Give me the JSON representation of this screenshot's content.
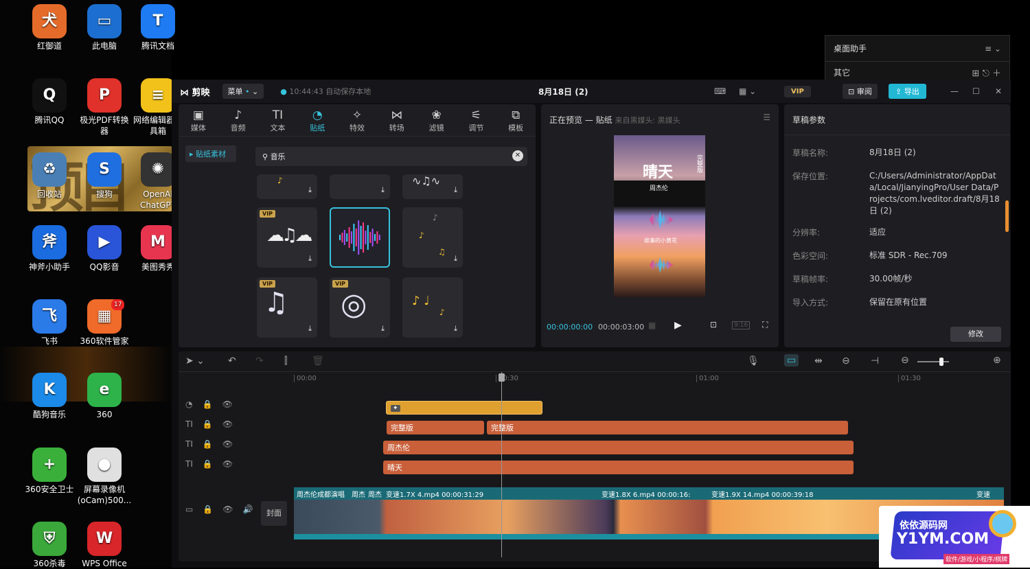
{
  "desktop": {
    "icons": [
      {
        "label": "红御道",
        "color": "#e56b2a",
        "glyph": "犬"
      },
      {
        "label": "此电脑",
        "color": "#1c6fd0",
        "glyph": "▭"
      },
      {
        "label": "腾讯文档",
        "color": "#1e7bf2",
        "glyph": "T"
      },
      {
        "label": "腾讯QQ",
        "color": "#111111",
        "glyph": "Q"
      },
      {
        "label": "极光PDF转换器",
        "color": "#e0322a",
        "glyph": "P"
      },
      {
        "label": "网络编辑器工具箱",
        "color": "#f2c21b",
        "glyph": "≡"
      },
      {
        "label": "回收站",
        "color": "#4a7fb5",
        "glyph": "♻"
      },
      {
        "label": "搜狗",
        "color": "#1f6fe0",
        "glyph": "S"
      },
      {
        "label": "OpenAI ChatGPT",
        "color": "#333333",
        "glyph": "✺"
      },
      {
        "label": "神斧小助手",
        "color": "#1a6ce0",
        "glyph": "斧"
      },
      {
        "label": "QQ影音",
        "color": "#2a55d8",
        "glyph": "▶"
      },
      {
        "label": "美图秀秀",
        "color": "#e8354f",
        "glyph": "M"
      },
      {
        "label": "飞书",
        "color": "#2a7ae8",
        "glyph": "飞"
      },
      {
        "label": "360软件管家",
        "color": "#f06a2a",
        "glyph": "▦",
        "badge": "17"
      },
      {
        "label": "酷狗音乐",
        "color": "#1b8ae8",
        "glyph": "K"
      },
      {
        "label": "360",
        "color": "#2db34a",
        "glyph": "e"
      },
      {
        "label": "360安全卫士",
        "color": "#3ab03a",
        "glyph": "+"
      },
      {
        "label": "屏幕录像机(oCam)500...",
        "color": "#e0e0e0",
        "glyph": "●"
      },
      {
        "label": "360杀毒",
        "color": "#3aa83a",
        "glyph": "⛨"
      },
      {
        "label": "WPS Office",
        "color": "#d8262a",
        "glyph": "W"
      }
    ],
    "helper": {
      "title": "桌面助手",
      "sub": "其它"
    }
  },
  "app": {
    "logo": "剪映",
    "menu": "菜单",
    "autosave": "10:44:43 自动保存本地",
    "project_title": "8月18日 (2)",
    "vip": "VIP",
    "review": "审阅",
    "export": "导出",
    "tools": [
      {
        "label": "媒体",
        "glyph": "▣"
      },
      {
        "label": "音频",
        "glyph": "♪"
      },
      {
        "label": "文本",
        "glyph": "TI"
      },
      {
        "label": "贴纸",
        "glyph": "◔"
      },
      {
        "label": "特效",
        "glyph": "✧"
      },
      {
        "label": "转场",
        "glyph": "⋈"
      },
      {
        "label": "滤镜",
        "glyph": "❀"
      },
      {
        "label": "调节",
        "glyph": "⚟"
      },
      {
        "label": "模板",
        "glyph": "⧉"
      }
    ],
    "sidebar_item": "贴纸素材",
    "search_value": "音乐",
    "preview_title": "正在预览 — 贴纸",
    "preview_sub": "来自黑媒头: 黑媒头",
    "preview_texts": {
      "big": "晴天",
      "artist": "周杰伦",
      "side": "完整版",
      "caption": "故事的小黄花"
    },
    "time_current": "00:00:00:00",
    "time_total": "00:00:03:00",
    "params": {
      "title": "草稿参数",
      "rows": [
        {
          "label": "草稿名称:",
          "value": "8月18日 (2)"
        },
        {
          "label": "保存位置:",
          "value": "C:/Users/Administrator/AppData/Local/JianyingPro/User Data/Projects/com.lveditor.draft/8月18日 (2)"
        },
        {
          "label": "分辨率:",
          "value": "适应"
        },
        {
          "label": "色彩空间:",
          "value": "标准 SDR - Rec.709"
        },
        {
          "label": "草稿帧率:",
          "value": "30.00帧/秒"
        },
        {
          "label": "导入方式:",
          "value": "保留在原有位置"
        }
      ],
      "modify": "修改"
    },
    "ruler": [
      "00:00",
      "00:30",
      "01:00",
      "01:30"
    ],
    "clips": {
      "text1a": "完整版",
      "text1b": "完整版",
      "text2": "周杰伦",
      "text3": "晴天",
      "cover": "封面",
      "video_labels": [
        "周杰伦成都演唱",
        "周杰",
        "周杰",
        "变速1.7X  4.mp4  00:00:31:29",
        "变速1.8X  6.mp4  00:00:16:",
        "变速1.9X  14.mp4  00:00:39:18",
        "变速"
      ]
    }
  },
  "watermark": {
    "line1": "依依源码网",
    "line2": "Y1YM.COM",
    "line3": "软件/游戏/小程序/棋牌"
  },
  "colors": {
    "accent": "#37c3dd",
    "sticker_track": "#e0a030",
    "text_track": "#c9603a",
    "video_bar": "#1c8fa0"
  }
}
